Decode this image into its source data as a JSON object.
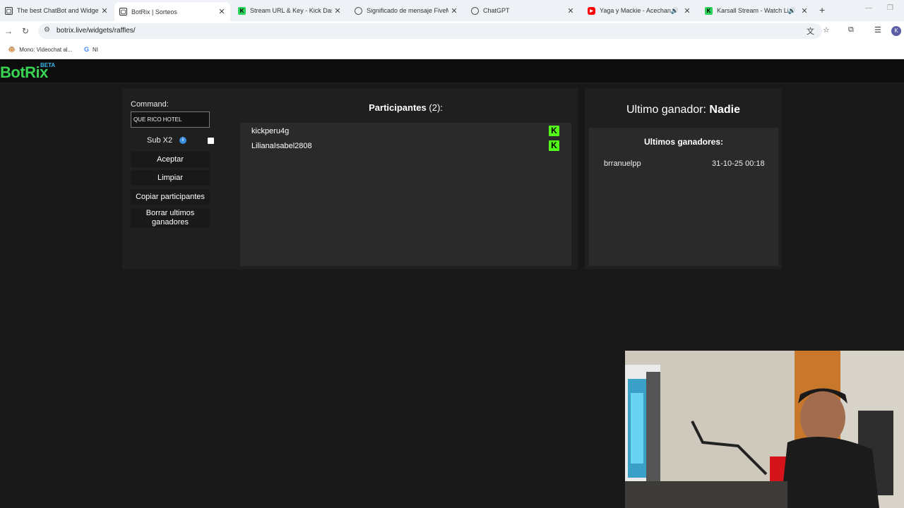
{
  "browser": {
    "tabs": [
      {
        "title": "The best ChatBot and Widgets",
        "active": false
      },
      {
        "title": "BotRix | Sorteos",
        "active": true
      },
      {
        "title": "Stream URL & Key - Kick Dashb",
        "active": false
      },
      {
        "title": "Significado de mensaje FiveM",
        "active": false
      },
      {
        "title": "ChatGPT",
        "active": false
      },
      {
        "title": "Yaga y Mackie - Acechando",
        "active": false
      },
      {
        "title": "Karsall Stream - Watch Live",
        "active": false
      }
    ],
    "url": "botrix.live/widgets/raffles/",
    "bookmarks": [
      {
        "label": "Mono: Videochat al..."
      },
      {
        "label": "NI"
      }
    ],
    "profile_initial": "K"
  },
  "site": {
    "logo": "BotRix",
    "badge": "BETA"
  },
  "raffle": {
    "command_label": "Command:",
    "command_value": "QUE RICO HOTEL",
    "sub_label": "Sub X2",
    "buttons": {
      "accept": "Aceptar",
      "clear": "Limpiar",
      "copy": "Copiar participantes",
      "delete": "Borrar ultimos ganadores"
    },
    "participants_title": "Participantes",
    "participants_count": "(2):",
    "participants": [
      {
        "name": "kickperu4g"
      },
      {
        "name": "LilianaIsabel2808"
      }
    ]
  },
  "winners": {
    "last_label": "Ultimo ganador:",
    "last_name": "Nadie",
    "list_title": "Ultimos ganadores:",
    "list": [
      {
        "name": "brranuelpp",
        "date": "31-10-25 00:18"
      }
    ]
  },
  "colors": {
    "brand_green": "#39d353",
    "kick_green": "#53fc18",
    "beta_blue": "#39b6e8"
  }
}
